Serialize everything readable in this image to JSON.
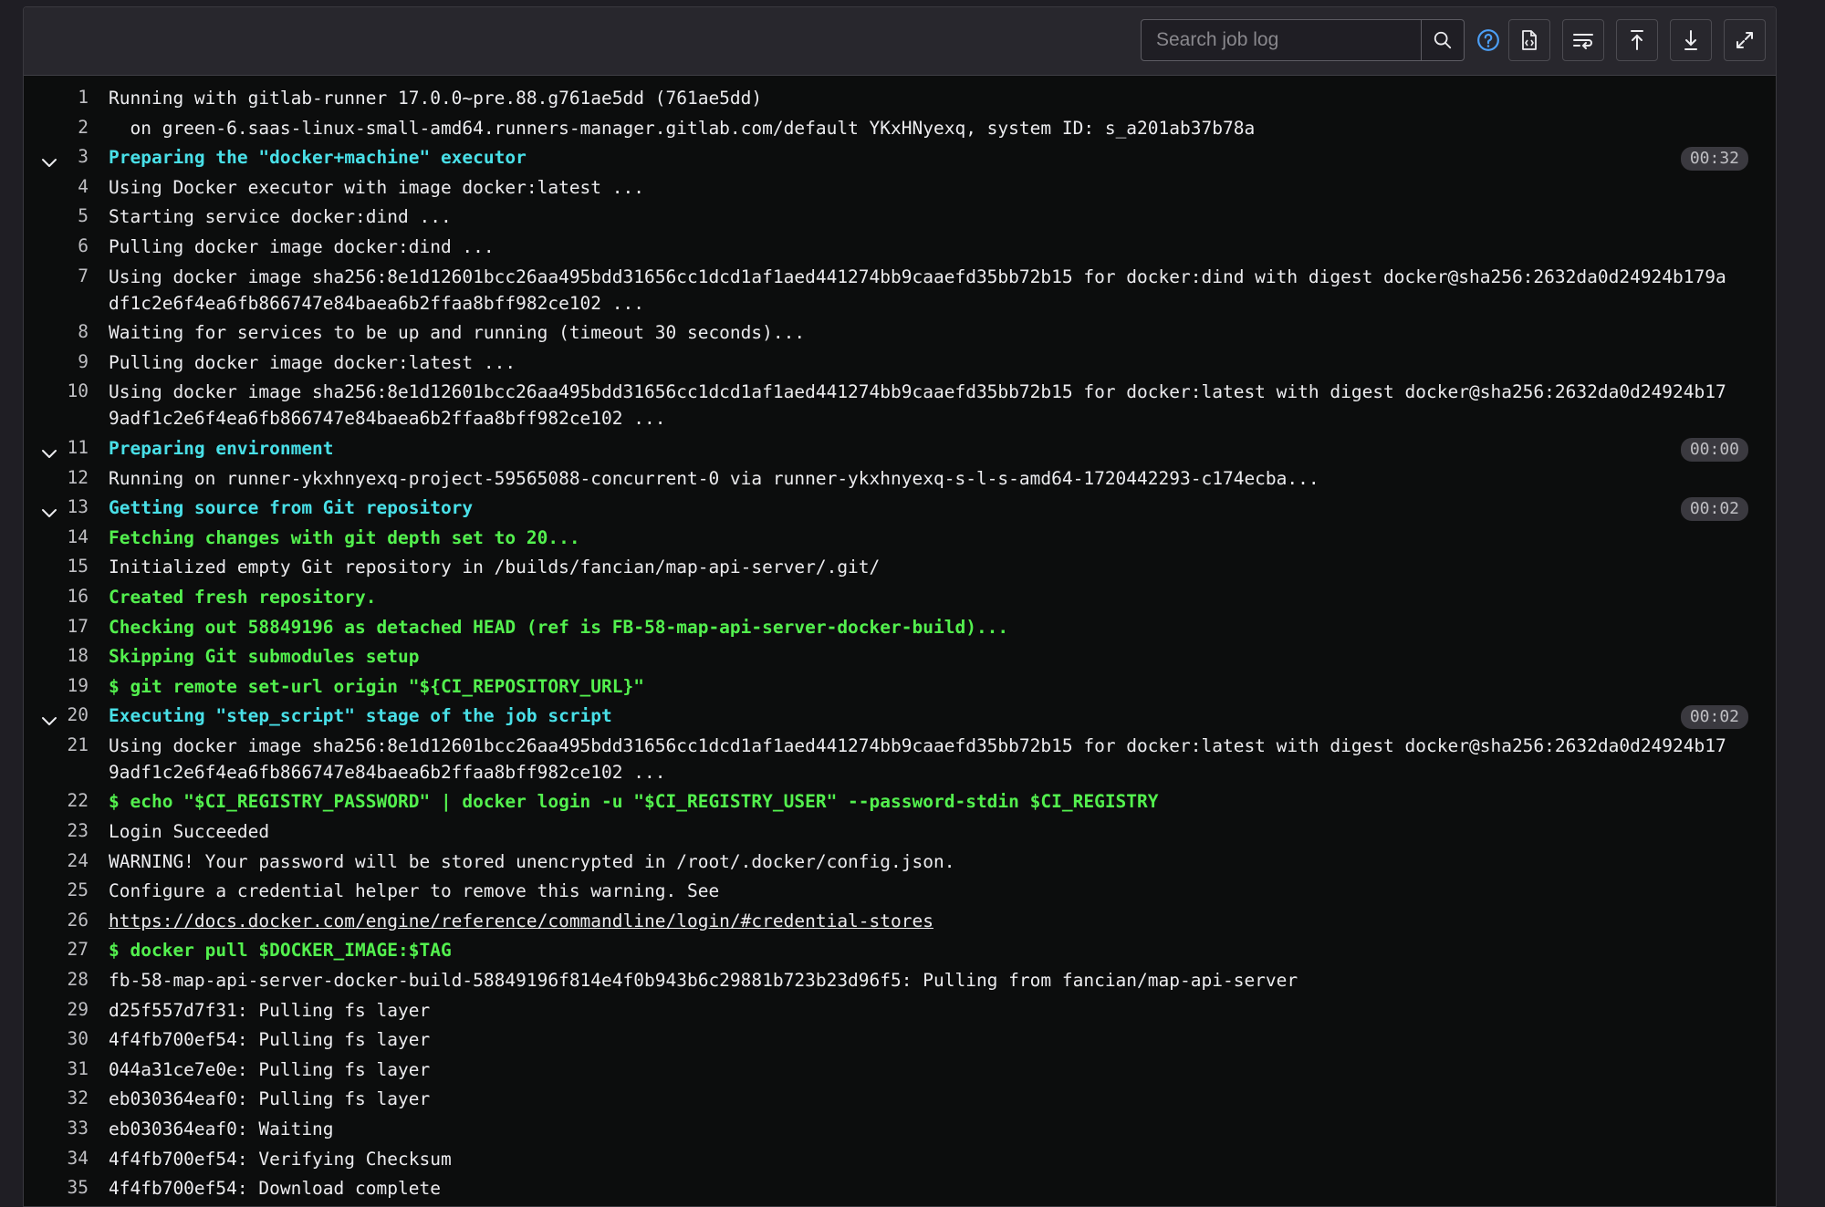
{
  "toolbar": {
    "search_placeholder": "Search job log",
    "icons": {
      "search": "search-icon",
      "help": "question-circle-icon",
      "raw": "document-code-icon",
      "wrap": "text-wrap-icon",
      "top": "scroll-to-top-icon",
      "bottom": "scroll-to-bottom-icon",
      "fullscreen": "maximize-icon"
    },
    "accent_color": "#4c9ff5"
  },
  "colors": {
    "section": "#49e0e8",
    "success": "#53f04e",
    "text": "#ececef",
    "background": "#0c0d0d"
  },
  "log": [
    {
      "n": "1",
      "t": "Running with gitlab-runner 17.0.0~pre.88.g761ae5dd (761ae5dd)",
      "s": "plain"
    },
    {
      "n": "2",
      "t": "  on green-6.saas-linux-small-amd64.runners-manager.gitlab.com/default YKxHNyexq, system ID: s_a201ab37b78a",
      "s": "plain"
    },
    {
      "n": "3",
      "t": "Preparing the \"docker+machine\" executor",
      "s": "section",
      "time": "00:32"
    },
    {
      "n": "4",
      "t": "Using Docker executor with image docker:latest ...",
      "s": "plain"
    },
    {
      "n": "5",
      "t": "Starting service docker:dind ...",
      "s": "plain"
    },
    {
      "n": "6",
      "t": "Pulling docker image docker:dind ...",
      "s": "plain"
    },
    {
      "n": "7",
      "t": "Using docker image sha256:8e1d12601bcc26aa495bdd31656cc1dcd1af1aed441274bb9caaefd35bb72b15 for docker:dind with digest docker@sha256:2632da0d24924b179adf1c2e6f4ea6fb866747e84baea6b2ffaa8bff982ce102 ...",
      "s": "plain"
    },
    {
      "n": "8",
      "t": "Waiting for services to be up and running (timeout 30 seconds)...",
      "s": "plain"
    },
    {
      "n": "9",
      "t": "Pulling docker image docker:latest ...",
      "s": "plain"
    },
    {
      "n": "10",
      "t": "Using docker image sha256:8e1d12601bcc26aa495bdd31656cc1dcd1af1aed441274bb9caaefd35bb72b15 for docker:latest with digest docker@sha256:2632da0d24924b179adf1c2e6f4ea6fb866747e84baea6b2ffaa8bff982ce102 ...",
      "s": "plain"
    },
    {
      "n": "11",
      "t": "Preparing environment",
      "s": "section",
      "time": "00:00"
    },
    {
      "n": "12",
      "t": "Running on runner-ykxhnyexq-project-59565088-concurrent-0 via runner-ykxhnyexq-s-l-s-amd64-1720442293-c174ecba...",
      "s": "plain"
    },
    {
      "n": "13",
      "t": "Getting source from Git repository",
      "s": "section",
      "time": "00:02"
    },
    {
      "n": "14",
      "t": "Fetching changes with git depth set to 20...",
      "s": "green"
    },
    {
      "n": "15",
      "t": "Initialized empty Git repository in /builds/fancian/map-api-server/.git/",
      "s": "plain"
    },
    {
      "n": "16",
      "t": "Created fresh repository.",
      "s": "green"
    },
    {
      "n": "17",
      "t": "Checking out 58849196 as detached HEAD (ref is FB-58-map-api-server-docker-build)...",
      "s": "green"
    },
    {
      "n": "18",
      "t": "Skipping Git submodules setup",
      "s": "green"
    },
    {
      "n": "19",
      "t": "$ git remote set-url origin \"${CI_REPOSITORY_URL}\"",
      "s": "green"
    },
    {
      "n": "20",
      "t": "Executing \"step_script\" stage of the job script",
      "s": "section",
      "time": "00:02"
    },
    {
      "n": "21",
      "t": "Using docker image sha256:8e1d12601bcc26aa495bdd31656cc1dcd1af1aed441274bb9caaefd35bb72b15 for docker:latest with digest docker@sha256:2632da0d24924b179adf1c2e6f4ea6fb866747e84baea6b2ffaa8bff982ce102 ...",
      "s": "plain"
    },
    {
      "n": "22",
      "t": "$ echo \"$CI_REGISTRY_PASSWORD\" | docker login -u \"$CI_REGISTRY_USER\" --password-stdin $CI_REGISTRY",
      "s": "green"
    },
    {
      "n": "23",
      "t": "Login Succeeded",
      "s": "plain"
    },
    {
      "n": "24",
      "t": "WARNING! Your password will be stored unencrypted in /root/.docker/config.json.",
      "s": "plain"
    },
    {
      "n": "25",
      "t": "Configure a credential helper to remove this warning. See",
      "s": "plain"
    },
    {
      "n": "26",
      "t": "https://docs.docker.com/engine/reference/commandline/login/#credential-stores",
      "s": "link"
    },
    {
      "n": "27",
      "t": "$ docker pull $DOCKER_IMAGE:$TAG",
      "s": "green"
    },
    {
      "n": "28",
      "t": "fb-58-map-api-server-docker-build-58849196f814e4f0b943b6c29881b723b23d96f5: Pulling from fancian/map-api-server",
      "s": "plain"
    },
    {
      "n": "29",
      "t": "d25f557d7f31: Pulling fs layer",
      "s": "plain"
    },
    {
      "n": "30",
      "t": "4f4fb700ef54: Pulling fs layer",
      "s": "plain"
    },
    {
      "n": "31",
      "t": "044a31ce7e0e: Pulling fs layer",
      "s": "plain"
    },
    {
      "n": "32",
      "t": "eb030364eaf0: Pulling fs layer",
      "s": "plain"
    },
    {
      "n": "33",
      "t": "eb030364eaf0: Waiting",
      "s": "plain"
    },
    {
      "n": "34",
      "t": "4f4fb700ef54: Verifying Checksum",
      "s": "plain"
    },
    {
      "n": "35",
      "t": "4f4fb700ef54: Download complete",
      "s": "plain"
    }
  ]
}
